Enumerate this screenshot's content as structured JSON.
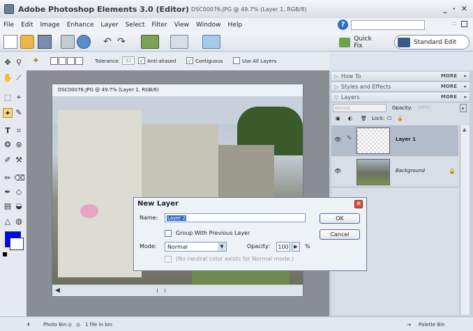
{
  "window": {
    "app_title": "Adobe Photoshop Elements 3.0 (Editor)",
    "doc_title": "DSC00076.JPG @ 49.7% (Layer 1, RGB/8)",
    "controls": [
      "_",
      "·",
      "✕"
    ]
  },
  "menu": {
    "items": [
      "File",
      "Edit",
      "Image",
      "Enhance",
      "Layer",
      "Select",
      "Filter",
      "View",
      "Window",
      "Help"
    ],
    "help_icon": "?",
    "grid_icon": "∷"
  },
  "modes": {
    "quick_fix": "Quick Fix",
    "standard_edit": "Standard Edit"
  },
  "options_bar": {
    "tolerance_label": "Tolerance:",
    "tolerance_value": "32",
    "anti_aliased_label": "Anti-aliased",
    "anti_aliased_checked": true,
    "contiguous_label": "Contiguous",
    "contiguous_checked": true,
    "use_all_layers_label": "Use All Layers",
    "use_all_layers_checked": false
  },
  "toolbox": {
    "colors": {
      "foreground": "#0000ff",
      "background": "#ffffff"
    }
  },
  "document": {
    "title": "DSC00076.JPG @ 49.7% (Layer 1, RGB/8)"
  },
  "palette_bin": {
    "sections": [
      {
        "label": "How To",
        "more": "MORE"
      },
      {
        "label": "Styles and Effects",
        "more": "MORE"
      },
      {
        "label": "Layers",
        "more": "MORE"
      }
    ],
    "layers_panel": {
      "blend_mode": "Normal",
      "opacity_label": "Opacity:",
      "opacity_value": "100%",
      "lock_label": "Lock:",
      "layers": [
        {
          "name": "Layer 1",
          "selected": true
        },
        {
          "name": "Background",
          "selected": false
        }
      ]
    }
  },
  "dialog": {
    "title": "New Layer",
    "name_label": "Name:",
    "name_value": "Layer 2",
    "group_label": "Group With Previous Layer",
    "mode_label": "Mode:",
    "mode_value": "Normal",
    "opacity_label": "Opacity:",
    "opacity_value": "100",
    "opacity_unit": "%",
    "neutral_label": "(No neutral color exists for Normal mode.)",
    "ok_label": "OK",
    "cancel_label": "Cancel"
  },
  "statusbar": {
    "photo_bin_label": "Photo Bin",
    "file_count": "1 file in bin",
    "palette_bin_label": "Palette Bin"
  }
}
